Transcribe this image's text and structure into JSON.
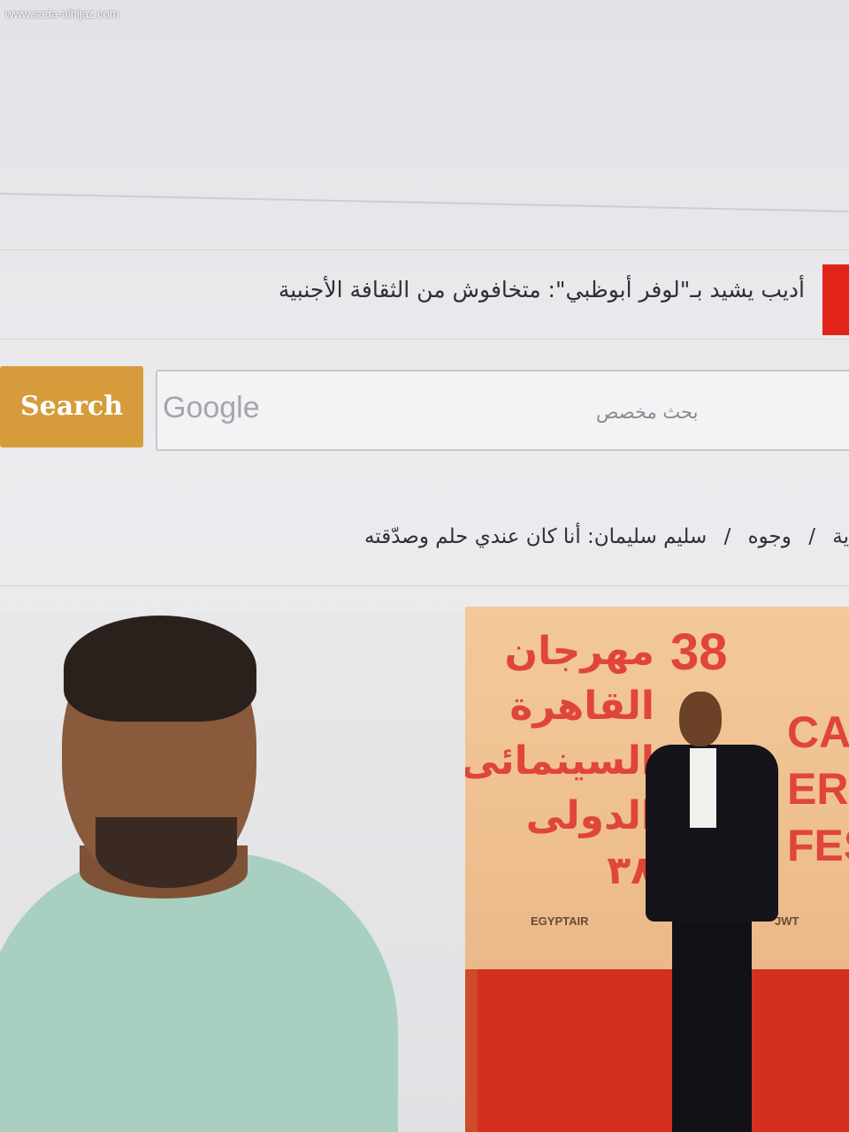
{
  "watermark": "www.sada-alhijaz.com",
  "ticker": {
    "headline": "أديب يشيد بـ\"لوفر أبوظبي\": متخافوش من الثقافة الأجنبية",
    "badge_color": "#e2231a"
  },
  "search": {
    "button_label": "Search",
    "provider_mark": "Google",
    "placeholder": "بحث مخصص",
    "button_color": "#d69b3a"
  },
  "breadcrumb": {
    "items": [
      "ية",
      "وجوه",
      "سليم سليمان: أنا كان عندي حلم وصدّقته"
    ],
    "separator": "/"
  },
  "photos": {
    "right": {
      "festival_arabic": "مهرجان القاهرة السينمائى الدولى ٣٨",
      "festival_number": "38",
      "festival_english": "CAIRO ERNAT FES",
      "sponsors": [
        "EGYPTAIR",
        "JWT"
      ]
    }
  }
}
